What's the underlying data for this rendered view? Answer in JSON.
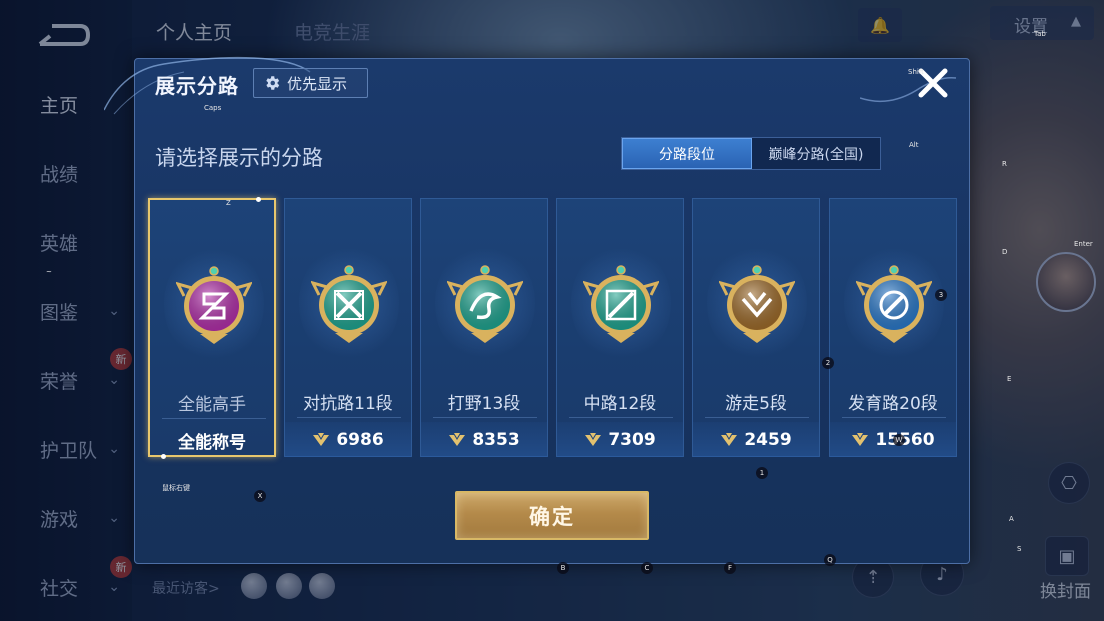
{
  "background": {
    "nav": [
      {
        "label": "主页",
        "active": true
      },
      {
        "label": "战绩"
      },
      {
        "label": "英雄"
      },
      {
        "label": "图鉴"
      },
      {
        "label": "荣誉"
      },
      {
        "label": "护卫队"
      },
      {
        "label": "游戏"
      },
      {
        "label": "社交"
      }
    ],
    "new_badge": "新",
    "top_tabs": [
      "个人主页",
      "电竞生涯"
    ],
    "settings_label": "设置",
    "recent_visitors": "最近访客>",
    "change_cover": "换封面"
  },
  "modal": {
    "title": "展示分路",
    "priority_button": "优先显示",
    "subtitle": "请选择展示的分路",
    "segments": [
      {
        "label": "分路段位",
        "active": true
      },
      {
        "label": "巅峰分路(全国)",
        "active": false
      }
    ],
    "cards": [
      {
        "name": "全能高手",
        "footer": "全能称号",
        "selected": true,
        "badge_color": "#b02fa8",
        "badge_icon": "all-round-icon"
      },
      {
        "name": "对抗路11段",
        "points": "6986",
        "badge_color": "#1fa38f",
        "badge_icon": "clash-lane-icon"
      },
      {
        "name": "打野13段",
        "points": "8353",
        "badge_color": "#1fa38f",
        "badge_icon": "jungle-icon"
      },
      {
        "name": "中路12段",
        "points": "7309",
        "badge_color": "#1fa38f",
        "badge_icon": "mid-lane-icon"
      },
      {
        "name": "游走5段",
        "points": "2459",
        "badge_color": "#9c6a2a",
        "badge_icon": "roam-icon"
      },
      {
        "name": "发育路20段",
        "points": "15560",
        "badge_color": "#2a78c8",
        "badge_icon": "farm-lane-icon"
      }
    ],
    "confirm": "确定"
  },
  "key_hints": {
    "caps": "Caps",
    "shift": "Shift",
    "tab": "Tab",
    "alt": "Alt",
    "enter": "Enter",
    "r": "R",
    "d": "D",
    "e": "E",
    "a": "A",
    "s": "S",
    "z": "Z",
    "x": "X",
    "b": "B",
    "c": "C",
    "f": "F",
    "q": "Q",
    "one": "1",
    "two": "2",
    "three": "3",
    "w": "W",
    "tilde": "~",
    "mouse": "鼠标右键"
  },
  "colors": {
    "accent_gold": "#e7c76d",
    "segment_active": "#3d7fd1",
    "modal_bg": "#1b3a6c"
  }
}
